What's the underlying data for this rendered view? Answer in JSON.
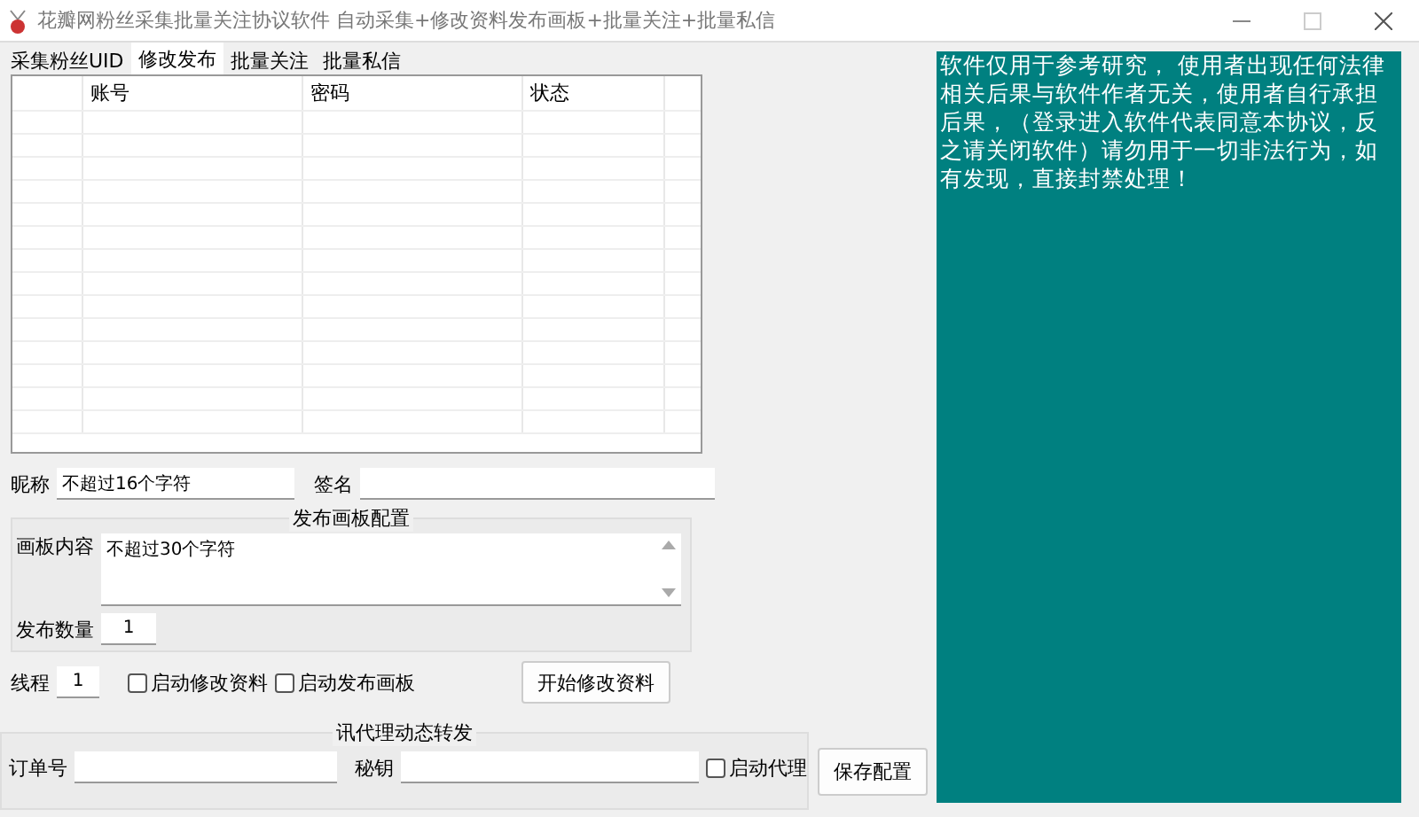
{
  "window": {
    "title": "花瓣网粉丝采集批量关注协议软件 自动采集+修改资料发布画板+批量关注+批量私信"
  },
  "tabs": [
    {
      "label": "采集粉丝UID",
      "selected": false
    },
    {
      "label": "修改发布",
      "selected": true
    },
    {
      "label": "批量关注",
      "selected": false
    },
    {
      "label": "批量私信",
      "selected": false
    }
  ],
  "table": {
    "columns": [
      "账号",
      "密码",
      "状态"
    ]
  },
  "profile": {
    "nickname_label": "昵称",
    "nickname_value": "不超过16个字符",
    "signature_label": "签名"
  },
  "board_group": {
    "title": "发布画板配置",
    "content_label": "画板内容",
    "content_value": "不超过30个字符",
    "count_label": "发布数量",
    "count_value": "1"
  },
  "thread": {
    "label": "线程",
    "value": "1"
  },
  "options": [
    {
      "label": "启动修改资料",
      "checked": false
    },
    {
      "label": "启动发布画板",
      "checked": false
    }
  ],
  "start_button": "开始修改资料",
  "proxy": {
    "title": "讯代理动态转发",
    "order_label": "订单号",
    "key_label": "秘钥",
    "enable": {
      "label": "启动代理",
      "checked": false
    }
  },
  "save_button": "保存配置",
  "notice": "软件仅用于参考研究， 使用者出现任何法律相关后果与软件作者无关，使用者自行承担后果，（登录进入软件代表同意本协议，反之请关闭软件）请勿用于一切非法行为，如有发现，直接封禁处理！"
}
